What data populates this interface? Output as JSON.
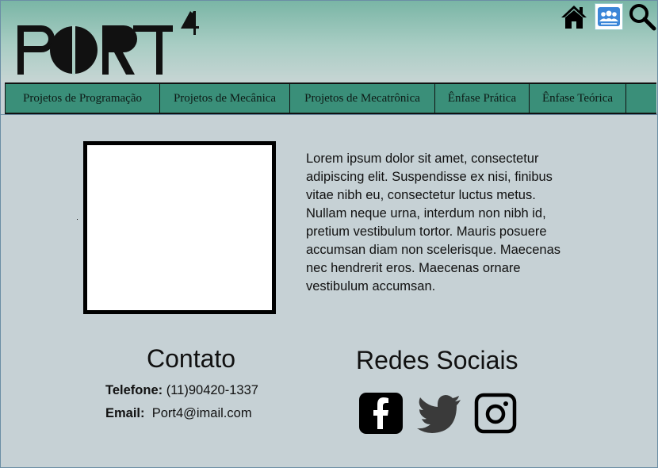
{
  "header": {
    "logo_text": "PORT4",
    "icons": {
      "home": "home-icon",
      "users": "users-icon",
      "search": "search-icon"
    }
  },
  "nav": {
    "items": [
      {
        "label": "Projetos de Programação"
      },
      {
        "label": "Projetos de Mecânica"
      },
      {
        "label": "Projetos de Mecatrônica"
      },
      {
        "label": "Ênfase Prática"
      },
      {
        "label": "Ênfase Teórica"
      }
    ]
  },
  "main": {
    "paragraph": "Lorem ipsum dolor sit amet, consectetur adipiscing elit. Suspendisse ex nisi, finibus vitae nibh eu, consectetur luctus metus. Nullam neque urna, interdum non nibh id, pretium vestibulum tortor. Mauris posuere accumsan diam non scelerisque. Maecenas nec hendrerit eros. Maecenas ornare vestibulum accumsan."
  },
  "contact": {
    "title": "Contato",
    "phone_label": "Telefone:",
    "phone": "(11)90420-1337",
    "email_label": "Email:",
    "email": "Port4@imail.com"
  },
  "social": {
    "title": "Redes Sociais",
    "icons": [
      "facebook-icon",
      "twitter-icon",
      "instagram-icon"
    ]
  },
  "colors": {
    "header_top": "#79b5a5",
    "nav_bg": "#3a8f79",
    "page_bg": "#c6d1d5"
  }
}
